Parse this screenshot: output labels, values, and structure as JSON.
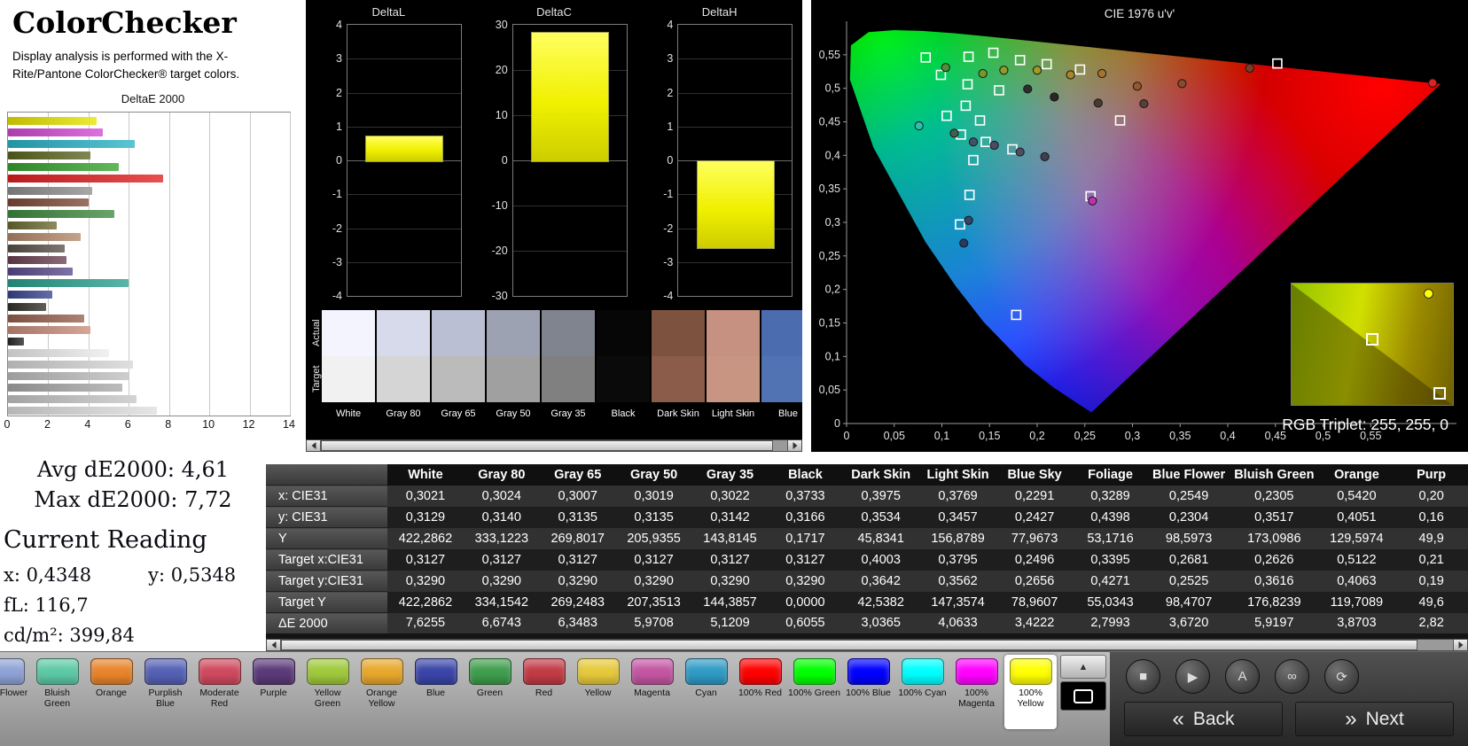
{
  "header": {
    "title": "ColorChecker",
    "description": "Display analysis is performed with the X-Rite/Pantone ColorChecker® target colors."
  },
  "deltae_chart": {
    "title": "DeltaE 2000",
    "x_ticks": [
      0,
      2,
      4,
      6,
      8,
      10,
      12,
      14
    ],
    "x_max": 14,
    "bars": [
      {
        "color": "#e8e400",
        "value": 4.4
      },
      {
        "color": "#d24ad2",
        "value": 4.7
      },
      {
        "color": "#2ab4c8",
        "value": 6.3
      },
      {
        "color": "#5a661f",
        "value": 4.1
      },
      {
        "color": "#37a32e",
        "value": 5.5
      },
      {
        "color": "#e02020",
        "value": 7.72
      },
      {
        "color": "#8f8f8f",
        "value": 4.2
      },
      {
        "color": "#7c4a38",
        "value": 4.0
      },
      {
        "color": "#3f8a3f",
        "value": 5.3
      },
      {
        "color": "#6a6a2f",
        "value": 2.4
      },
      {
        "color": "#b5886a",
        "value": 3.6
      },
      {
        "color": "#58504a",
        "value": 2.8
      },
      {
        "color": "#6b4050",
        "value": 2.9
      },
      {
        "color": "#5a4a8c",
        "value": 3.2
      },
      {
        "color": "#2aa08c",
        "value": 6.0
      },
      {
        "color": "#39458f",
        "value": 2.2
      },
      {
        "color": "#33302b",
        "value": 1.9
      },
      {
        "color": "#96604e",
        "value": 3.8
      },
      {
        "color": "#c98e7c",
        "value": 4.1
      },
      {
        "color": "#262626",
        "value": 0.8
      },
      {
        "color": "#ededed",
        "value": 5.0
      },
      {
        "color": "#d6d6d6",
        "value": 6.2
      },
      {
        "color": "#bfbfbf",
        "value": 6.0
      },
      {
        "color": "#a9a9a9",
        "value": 5.7
      },
      {
        "color": "#c7c7c7",
        "value": 6.4
      },
      {
        "color": "#dedede",
        "value": 7.4
      }
    ]
  },
  "delta_charts": [
    {
      "title": "DeltaL",
      "min": -4,
      "max": 4,
      "step": 1,
      "value": 0.72
    },
    {
      "title": "DeltaC",
      "min": -30,
      "max": 30,
      "step": 10,
      "value": 28.5
    },
    {
      "title": "DeltaH",
      "min": -4,
      "max": 4,
      "step": 1,
      "value": -2.55
    }
  ],
  "patches": {
    "row_labels": [
      "Actual",
      "Target"
    ],
    "columns": [
      {
        "label": "White",
        "actual": "#f3f4fe",
        "target": "#f1f1f1"
      },
      {
        "label": "Gray 80",
        "actual": "#d7daea",
        "target": "#d5d5d5"
      },
      {
        "label": "Gray 65",
        "actual": "#babfd3",
        "target": "#bbbbbb"
      },
      {
        "label": "Gray 50",
        "actual": "#9da2b3",
        "target": "#a0a0a0"
      },
      {
        "label": "Gray 35",
        "actual": "#80848e",
        "target": "#808080"
      },
      {
        "label": "Black",
        "actual": "#060607",
        "target": "#0a0a0a"
      },
      {
        "label": "Dark Skin",
        "actual": "#7d5340",
        "target": "#8a5c49"
      },
      {
        "label": "Light Skin",
        "actual": "#c69180",
        "target": "#c89582"
      },
      {
        "label": "Blue",
        "actual": "#4c6cb0",
        "target": "#5173b4"
      }
    ]
  },
  "cie": {
    "title": "CIE 1976 u'v'",
    "rgb_triplet_label": "RGB Triplet: 255, 255, 0",
    "x_ticks": [
      "0",
      "0,05",
      "0,1",
      "0,15",
      "0,2",
      "0,25",
      "0,3",
      "0,35",
      "0,4",
      "0,45",
      "0,5",
      "0,55"
    ],
    "y_ticks": [
      "0",
      "0,05",
      "0,1",
      "0,15",
      "0,2",
      "0,25",
      "0,3",
      "0,35",
      "0,4",
      "0,45",
      "0,5",
      "0,55"
    ],
    "targets": [
      [
        0.083,
        0.546
      ],
      [
        0.099,
        0.52
      ],
      [
        0.128,
        0.547
      ],
      [
        0.154,
        0.553
      ],
      [
        0.182,
        0.542
      ],
      [
        0.21,
        0.536
      ],
      [
        0.245,
        0.528
      ],
      [
        0.452,
        0.537
      ],
      [
        0.127,
        0.506
      ],
      [
        0.16,
        0.497
      ],
      [
        0.125,
        0.474
      ],
      [
        0.105,
        0.459
      ],
      [
        0.14,
        0.452
      ],
      [
        0.287,
        0.452
      ],
      [
        0.12,
        0.431
      ],
      [
        0.146,
        0.42
      ],
      [
        0.174,
        0.409
      ],
      [
        0.133,
        0.393
      ],
      [
        0.129,
        0.341
      ],
      [
        0.256,
        0.339
      ],
      [
        0.119,
        0.297
      ],
      [
        0.178,
        0.162
      ]
    ],
    "measurements": [
      [
        0.104,
        0.531,
        "#4f8f35"
      ],
      [
        0.143,
        0.522,
        "#76982b"
      ],
      [
        0.165,
        0.527,
        "#8f9c28"
      ],
      [
        0.2,
        0.527,
        "#a39a22"
      ],
      [
        0.235,
        0.52,
        "#a8862a"
      ],
      [
        0.268,
        0.522,
        "#a8742e"
      ],
      [
        0.305,
        0.503,
        "#96572e"
      ],
      [
        0.352,
        0.507,
        "#8a4a2c"
      ],
      [
        0.423,
        0.53,
        "#7a3a28"
      ],
      [
        0.19,
        0.499,
        "#2e2e2e"
      ],
      [
        0.218,
        0.487,
        "#262626"
      ],
      [
        0.264,
        0.478,
        "#4a3a30"
      ],
      [
        0.312,
        0.477,
        "#55403a"
      ],
      [
        0.113,
        0.433,
        "#3f5f50"
      ],
      [
        0.133,
        0.42,
        "#42526b"
      ],
      [
        0.155,
        0.415,
        "#4e4a66"
      ],
      [
        0.182,
        0.405,
        "#4e4e62"
      ],
      [
        0.208,
        0.398,
        "#3f3f52"
      ],
      [
        0.258,
        0.332,
        "#c02fae"
      ],
      [
        0.128,
        0.303,
        "#32456b"
      ],
      [
        0.123,
        0.269,
        "#233c66"
      ],
      [
        0.615,
        0.508,
        "#e02222"
      ],
      [
        0.076,
        0.444,
        "#2fbfae"
      ]
    ]
  },
  "stats": {
    "avg_label": "Avg dE2000: 4,61",
    "max_label": "Max dE2000: 7,72",
    "current_heading": "Current Reading",
    "x": "x: 0,4348",
    "y": "y: 0,5348",
    "fl": "fL: 116,7",
    "cd": "cd/m²: 399,84"
  },
  "table": {
    "corner": "",
    "columns": [
      "White",
      "Gray 80",
      "Gray 65",
      "Gray 50",
      "Gray 35",
      "Black",
      "Dark Skin",
      "Light Skin",
      "Blue Sky",
      "Foliage",
      "Blue Flower",
      "Bluish Green",
      "Orange",
      "Purp"
    ],
    "rows": [
      {
        "label": "x: CIE31",
        "values": [
          "0,3021",
          "0,3024",
          "0,3007",
          "0,3019",
          "0,3022",
          "0,3733",
          "0,3975",
          "0,3769",
          "0,2291",
          "0,3289",
          "0,2549",
          "0,2305",
          "0,5420",
          "0,20"
        ]
      },
      {
        "label": "y: CIE31",
        "values": [
          "0,3129",
          "0,3140",
          "0,3135",
          "0,3135",
          "0,3142",
          "0,3166",
          "0,3534",
          "0,3457",
          "0,2427",
          "0,4398",
          "0,2304",
          "0,3517",
          "0,4051",
          "0,16"
        ]
      },
      {
        "label": "Y",
        "values": [
          "422,2862",
          "333,1223",
          "269,8017",
          "205,9355",
          "143,8145",
          "0,1717",
          "45,8341",
          "156,8789",
          "77,9673",
          "53,1716",
          "98,5973",
          "173,0986",
          "129,5974",
          "49,9"
        ]
      },
      {
        "label": "Target x:CIE31",
        "values": [
          "0,3127",
          "0,3127",
          "0,3127",
          "0,3127",
          "0,3127",
          "0,3127",
          "0,4003",
          "0,3795",
          "0,2496",
          "0,3395",
          "0,2681",
          "0,2626",
          "0,5122",
          "0,21"
        ]
      },
      {
        "label": "Target y:CIE31",
        "values": [
          "0,3290",
          "0,3290",
          "0,3290",
          "0,3290",
          "0,3290",
          "0,3290",
          "0,3642",
          "0,3562",
          "0,2656",
          "0,4271",
          "0,2525",
          "0,3616",
          "0,4063",
          "0,19"
        ]
      },
      {
        "label": "Target Y",
        "values": [
          "422,2862",
          "334,1542",
          "269,2483",
          "207,3513",
          "144,3857",
          "0,0000",
          "42,5382",
          "147,3574",
          "78,9607",
          "55,0343",
          "98,4707",
          "176,8239",
          "119,7089",
          "49,6"
        ]
      },
      {
        "label": "ΔE 2000",
        "values": [
          "7,6255",
          "6,6743",
          "6,3483",
          "5,9708",
          "5,1209",
          "0,6055",
          "3,0365",
          "4,0633",
          "3,4222",
          "2,7993",
          "3,6720",
          "5,9197",
          "3,8703",
          "2,82"
        ]
      }
    ]
  },
  "palette": {
    "items": [
      {
        "label": "Blue Flower",
        "color": "#8fa3d6",
        "partial": true
      },
      {
        "label": "Bluish Green",
        "color": "#5dc9a6"
      },
      {
        "label": "Orange",
        "color": "#e8842b"
      },
      {
        "label": "Purplish Blue",
        "color": "#5561b5"
      },
      {
        "label": "Moderate Red",
        "color": "#cf4a5e"
      },
      {
        "label": "Purple",
        "color": "#5b3a79"
      },
      {
        "label": "Yellow Green",
        "color": "#a0c93c"
      },
      {
        "label": "Orange Yellow",
        "color": "#e8a82d"
      },
      {
        "label": "Blue",
        "color": "#3a45a8"
      },
      {
        "label": "Green",
        "color": "#3f9e4d"
      },
      {
        "label": "Red",
        "color": "#c23b45"
      },
      {
        "label": "Yellow",
        "color": "#e6c93c"
      },
      {
        "label": "Magenta",
        "color": "#c356a2"
      },
      {
        "label": "Cyan",
        "color": "#2f9bc5"
      },
      {
        "label": "100% Red",
        "color": "#ff0000"
      },
      {
        "label": "100% Green",
        "color": "#00ff00"
      },
      {
        "label": "100% Blue",
        "color": "#0000ff"
      },
      {
        "label": "100% Cyan",
        "color": "#00ffff"
      },
      {
        "label": "100% Magenta",
        "color": "#ff00ff"
      },
      {
        "label": "100% Yellow",
        "color": "#ffff00",
        "selected": true
      }
    ]
  },
  "transport": {
    "eject_glyph": "▲",
    "buttons": [
      {
        "name": "stop",
        "glyph": "■"
      },
      {
        "name": "play",
        "glyph": "▶"
      },
      {
        "name": "auto",
        "glyph": "A"
      },
      {
        "name": "loop",
        "glyph": "∞"
      },
      {
        "name": "refresh",
        "glyph": "⟳"
      }
    ],
    "back": {
      "chevron": "«",
      "label": "Back"
    },
    "next": {
      "chevron": "»",
      "label": "Next"
    }
  },
  "colors": {
    "accent_yellow": "#ffff00",
    "panel_black": "#000000",
    "bar_gray": "#8d8d8d"
  }
}
